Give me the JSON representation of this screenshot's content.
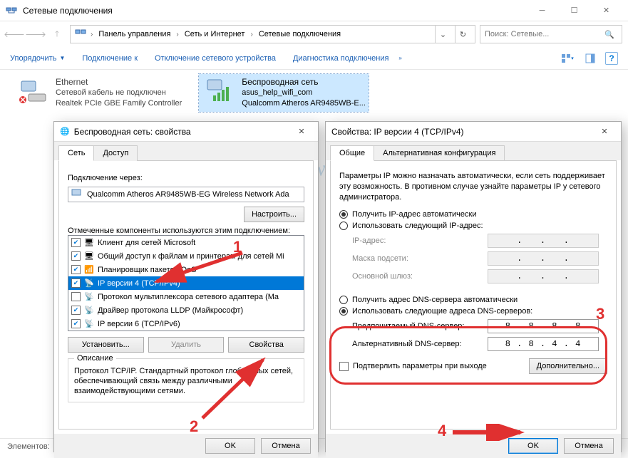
{
  "titlebar": {
    "title": "Сетевые подключения"
  },
  "breadcrumb": {
    "p1": "Панель управления",
    "p2": "Сеть и Интернет",
    "p3": "Сетевые подключения"
  },
  "searchbox": {
    "placeholder": "Поиск: Сетевые..."
  },
  "toolbar": {
    "organize": "Упорядочить",
    "connect": "Подключение к",
    "disable": "Отключение сетевого устройства",
    "diag": "Диагностика подключения"
  },
  "adapters": {
    "eth": {
      "name": "Ethernet",
      "status": "Сетевой кабель не подключен",
      "device": "Realtek PCIe GBE Family Controller"
    },
    "wifi": {
      "name": "Беспроводная сеть",
      "status": "asus_help_wifi_com",
      "device": "Qualcomm Atheros AR9485WB-E..."
    }
  },
  "dlg1": {
    "title": "Беспроводная сеть: свойства",
    "tabs": {
      "net": "Сеть",
      "access": "Доступ"
    },
    "conn_label": "Подключение через:",
    "adapter": "Qualcomm Atheros AR9485WB-EG Wireless Network Ada",
    "configure": "Настроить...",
    "components_label": "Отмеченные компоненты используются этим подключением:",
    "items": {
      "i1": "Клиент для сетей Microsoft",
      "i2": "Общий доступ к файлам и принтерам для сетей Mi",
      "i3": "Планировщик пакетов QoS",
      "i4": "IP версии 4 (TCP/IPv4)",
      "i5": "Протокол мультиплексора сетевого адаптера (Ma",
      "i6": "Драйвер протокола LLDP (Майкрософт)",
      "i7": "IP версии 6 (TCP/IPv6)"
    },
    "install": "Установить...",
    "remove": "Удалить",
    "properties": "Свойства",
    "desc_title": "Описание",
    "desc_text": "Протокол TCP/IP. Стандартный протокол глобальных сетей, обеспечивающий связь между различными взаимодействующими сетями.",
    "ok": "OK",
    "cancel": "Отмена"
  },
  "dlg2": {
    "title": "Свойства: IP версии 4 (TCP/IPv4)",
    "tabs": {
      "general": "Общие",
      "alt": "Альтернативная конфигурация"
    },
    "intro": "Параметры IP можно назначать автоматически, если сеть поддерживает эту возможность. В противном случае узнайте параметры IP у сетевого администратора.",
    "r_auto_ip": "Получить IP-адрес автоматически",
    "r_manual_ip": "Использовать следующий IP-адрес:",
    "ip_label": "IP-адрес:",
    "mask_label": "Маска подсети:",
    "gw_label": "Основной шлюз:",
    "r_auto_dns": "Получить адрес DNS-сервера автоматически",
    "r_manual_dns": "Использовать следующие адреса DNS-серверов:",
    "dns1_label": "Предпочитаемый DNS-сервер:",
    "dns2_label": "Альтернативный DNS-сервер:",
    "dns1_value": "8 . 8 . 8 . 8",
    "dns2_value": "8 . 8 . 4 . 4",
    "confirm": "Подтверлить параметры при выходе",
    "advanced": "Дополнительно...",
    "ok": "OK",
    "cancel": "Отмена"
  },
  "statusbar": {
    "count_label": "Элементов:"
  },
  "annotations": {
    "n1": "1",
    "n2": "2",
    "n3": "3",
    "n4": "4"
  },
  "watermark": "help-wifi.com"
}
